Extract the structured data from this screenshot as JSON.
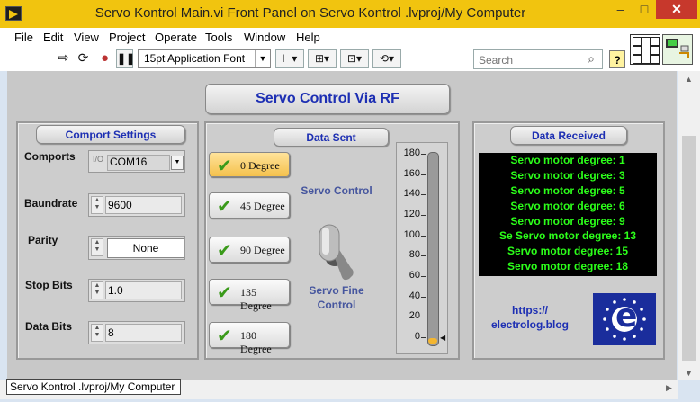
{
  "window": {
    "title": "Servo Kontrol Main.vi Front Panel on Servo Kontrol .lvproj/My Computer",
    "minimize": "–",
    "maximize": "□",
    "close": "✕"
  },
  "menu": [
    "File",
    "Edit",
    "View",
    "Project",
    "Operate",
    "Tools",
    "Window",
    "Help"
  ],
  "toolbar": {
    "font": "15pt Application Font",
    "search_placeholder": "Search",
    "help": "?"
  },
  "panel": {
    "main_title": "Servo Control Via RF",
    "comport": {
      "header": "Comport Settings",
      "comports_label": "Comports",
      "comports_value": "COM16",
      "baudrate_label": "Baundrate",
      "baudrate_value": "9600",
      "parity_label": "Parity",
      "parity_value": "None",
      "stopbits_label": "Stop Bits",
      "stopbits_value": "1.0",
      "databits_label": "Data Bits",
      "databits_value": "8"
    },
    "data_sent": {
      "header": "Data Sent",
      "buttons": [
        "0 Degree",
        "45 Degree",
        "90 Degree",
        "135 Degree",
        "180 Degree"
      ],
      "active_button": "0 Degree",
      "servo_control_label": "Servo Control",
      "fine_control_label": "Servo Fine Control",
      "slider_ticks": [
        "180",
        "160",
        "140",
        "120",
        "100",
        "80",
        "60",
        "40",
        "20",
        "0"
      ],
      "slider_value": 0
    },
    "data_received": {
      "header": "Data Received",
      "lines": [
        "Servo motor degree: 1",
        "Servo motor degree: 3",
        "Servo motor degree: 5",
        "Servo motor degree: 6",
        "Servo motor degree: 9",
        "Se Servo motor degree: 13",
        "Servo motor degree: 15",
        "Servo motor degree: 18"
      ],
      "website": "https://\nelectrolog.blog",
      "logo_letter": "e"
    }
  },
  "status": {
    "context": "Servo Kontrol .lvproj/My Computer"
  },
  "colors": {
    "titlebar": "#f1c40f",
    "header_text": "#1d2fb3",
    "display_text": "#2cff1a",
    "logo_bg": "#1a2d9c"
  }
}
